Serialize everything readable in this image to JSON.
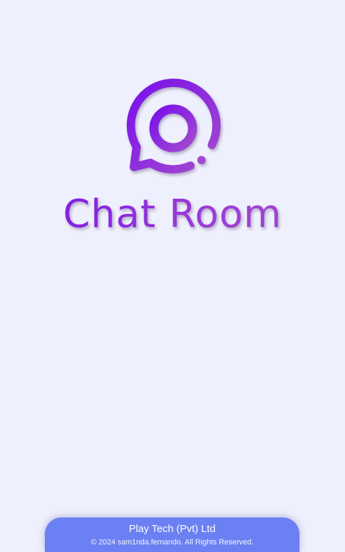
{
  "app": {
    "title": "Chat Room",
    "logo_icon": "chat-bubble-at-icon"
  },
  "footer": {
    "company": "Play Tech (Pvt) Ltd",
    "copyright": "© 2024 sam1nda.fernando. All Rights Reserved."
  },
  "colors": {
    "background": "#EFF0FD",
    "brand_purple": "#8A2BE2",
    "brand_purple_light": "#A349D0",
    "footer_background": "#6B80F2",
    "footer_text": "#FFFFFF"
  }
}
